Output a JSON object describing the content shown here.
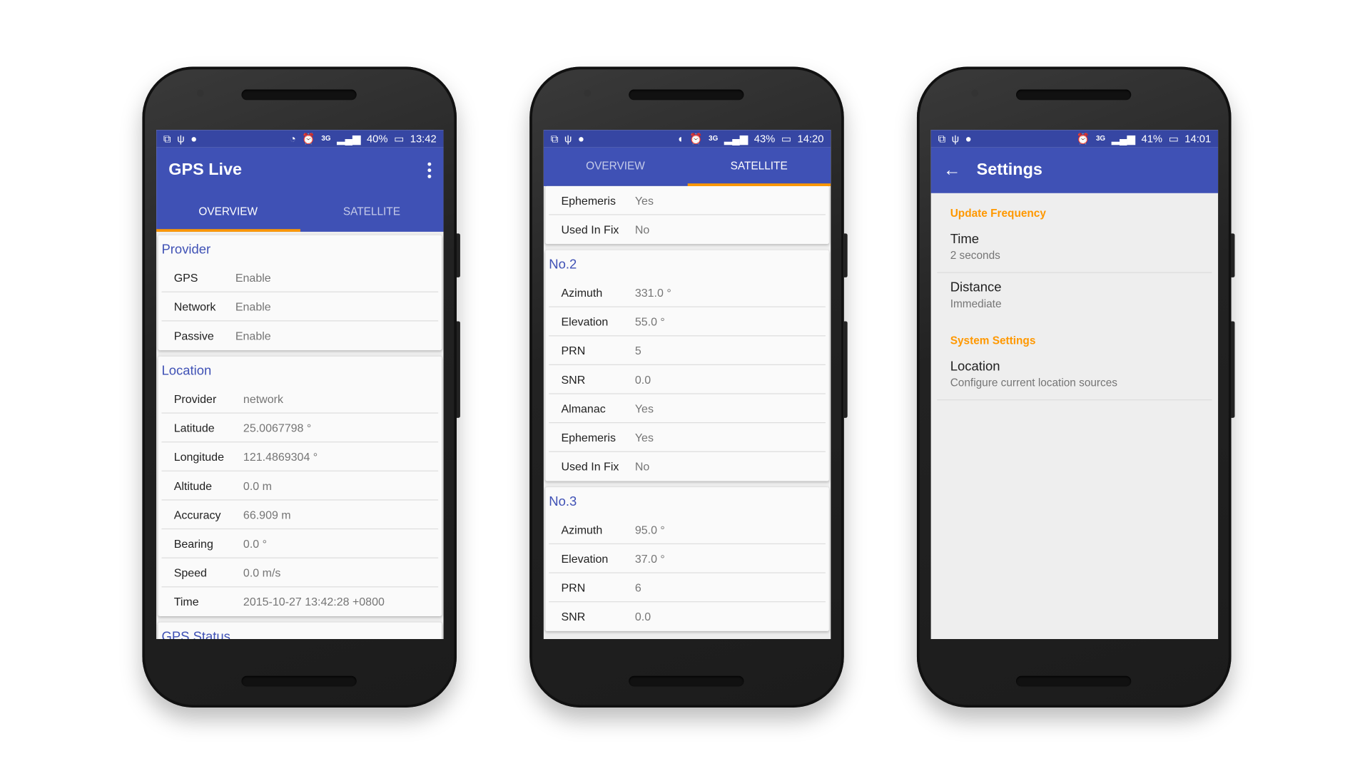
{
  "colors": {
    "primary": "#3f51b5",
    "status_bar": "#3646a3",
    "accent": "#ff9800"
  },
  "phones": [
    {
      "status": {
        "icons": [
          "code-icon",
          "usb-icon",
          "android-icon",
          "location-icon",
          "alarm-icon",
          "3g-icon",
          "signal-icon",
          "battery-charging-icon"
        ],
        "battery": "40%",
        "time": "13:42"
      },
      "title": "GPS Live",
      "tabs": [
        "OVERVIEW",
        "SATELLITE"
      ],
      "cards": [
        {
          "title": "Provider",
          "rows": [
            [
              "GPS",
              "Enable"
            ],
            [
              "Network",
              "Enable"
            ],
            [
              "Passive",
              "Enable"
            ]
          ]
        },
        {
          "title": "Location",
          "rows": [
            [
              "Provider",
              "network"
            ],
            [
              "Latitude",
              "25.0067798 °"
            ],
            [
              "Longitude",
              "121.4869304 °"
            ],
            [
              "Altitude",
              "0.0 m"
            ],
            [
              "Accuracy",
              "66.909 m"
            ],
            [
              "Bearing",
              "0.0 °"
            ],
            [
              "Speed",
              "0.0 m/s"
            ],
            [
              "Time",
              "2015-10-27 13:42:28 +0800"
            ]
          ]
        },
        {
          "title": "GPS Status",
          "rows": []
        }
      ]
    },
    {
      "status": {
        "battery": "43%",
        "time": "14:20"
      },
      "tabs": [
        "OVERVIEW",
        "SATELLITE"
      ],
      "cards": [
        {
          "title": "",
          "rows": [
            [
              "Ephemeris",
              "Yes"
            ],
            [
              "Used In Fix",
              "No"
            ]
          ]
        },
        {
          "title": "No.2",
          "rows": [
            [
              "Azimuth",
              "331.0 °"
            ],
            [
              "Elevation",
              "55.0 °"
            ],
            [
              "PRN",
              "5"
            ],
            [
              "SNR",
              "0.0"
            ],
            [
              "Almanac",
              "Yes"
            ],
            [
              "Ephemeris",
              "Yes"
            ],
            [
              "Used In Fix",
              "No"
            ]
          ]
        },
        {
          "title": "No.3",
          "rows": [
            [
              "Azimuth",
              "95.0 °"
            ],
            [
              "Elevation",
              "37.0 °"
            ],
            [
              "PRN",
              "6"
            ],
            [
              "SNR",
              "0.0"
            ]
          ]
        }
      ]
    },
    {
      "status": {
        "battery": "41%",
        "time": "14:01"
      },
      "title": "Settings",
      "categories": [
        {
          "title": "Update Frequency",
          "items": [
            {
              "title": "Time",
              "summary": "2 seconds"
            },
            {
              "title": "Distance",
              "summary": "Immediate"
            }
          ]
        },
        {
          "title": "System Settings",
          "items": [
            {
              "title": "Location",
              "summary": "Configure current location sources"
            }
          ]
        }
      ]
    }
  ]
}
